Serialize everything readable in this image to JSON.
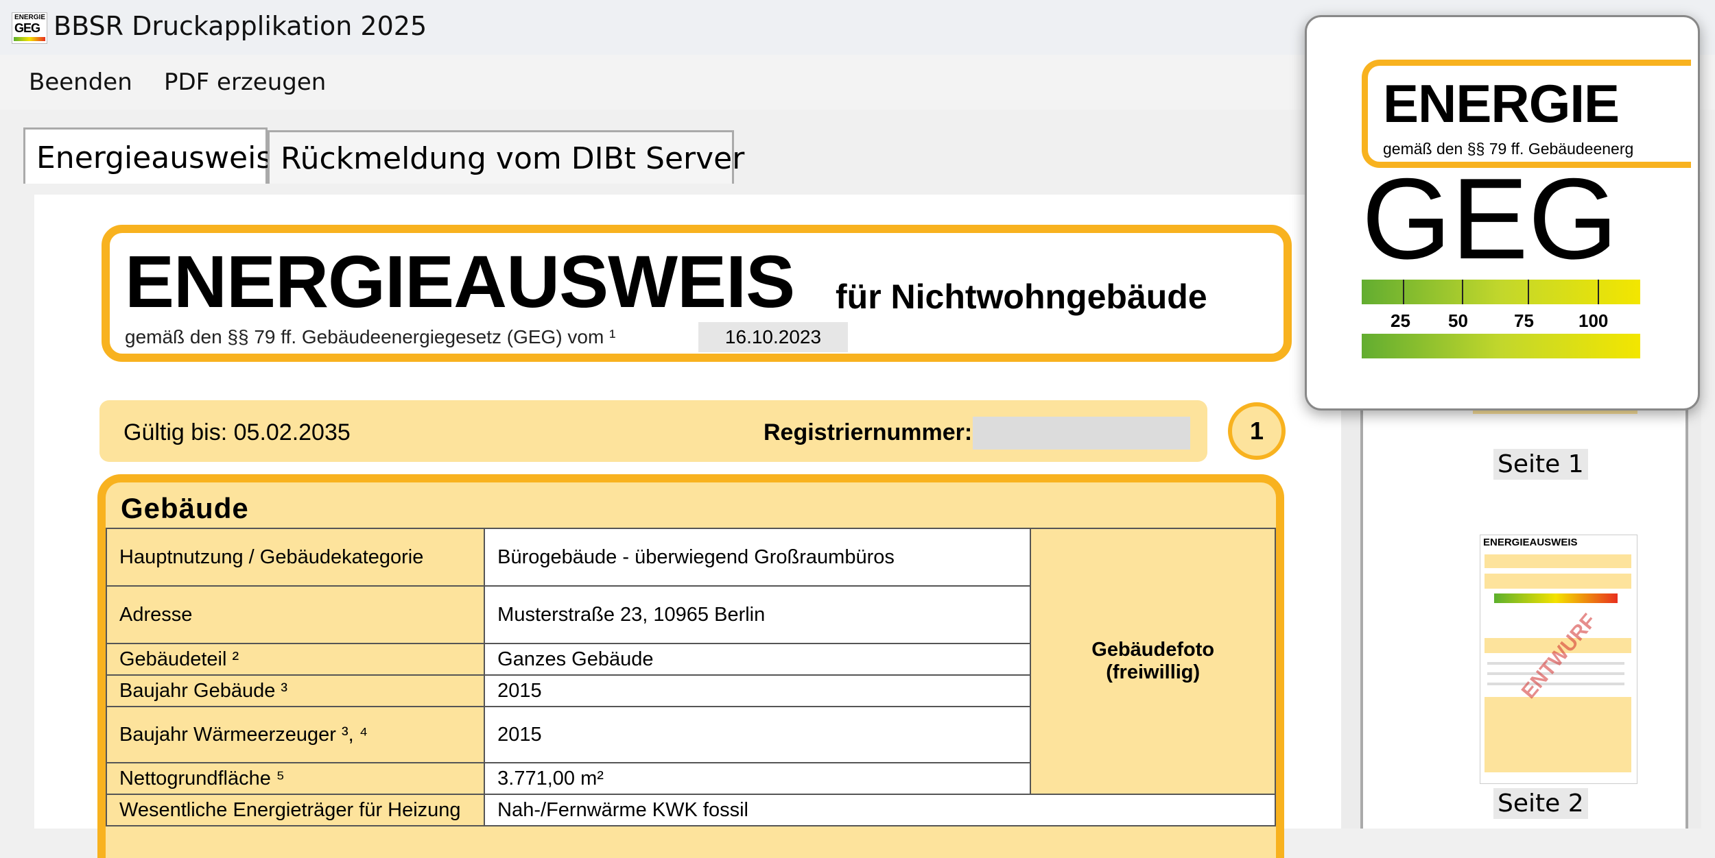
{
  "window": {
    "title": "BBSR Druckapplikation 2025",
    "icon_text_top": "ENERGIE",
    "icon_text_main": "GEG"
  },
  "menu": {
    "items": [
      "Beenden",
      "PDF erzeugen"
    ]
  },
  "tabs": [
    {
      "label": "Energieausweis",
      "active": true
    },
    {
      "label": "Rückmeldung vom DIBt Server",
      "active": false
    }
  ],
  "certificate": {
    "title": "ENERGIEAUSWEIS",
    "subtitle": "für Nichtwohngebäude",
    "law_line": "gemäß den §§ 79 ff. Gebäudeenergiegesetz (GEG) vom ¹",
    "law_date": "16.10.2023",
    "valid_until": "Gültig bis: 05.02.2035",
    "registration_label": "Registriernummer:",
    "registration_value": "",
    "page_badge": "1",
    "building": {
      "section_title": "Gebäude",
      "photo_label_line1": "Gebäudefoto",
      "photo_label_line2": "(freiwillig)",
      "rows": [
        {
          "label": "Hauptnutzung / Gebäudekategorie",
          "value": "Bürogebäude - überwiegend Großraumbüros"
        },
        {
          "label": "Adresse",
          "value": "Musterstraße 23, 10965 Berlin"
        },
        {
          "label": "Gebäudeteil ²",
          "value": "Ganzes Gebäude"
        },
        {
          "label": "Baujahr Gebäude ³",
          "value": "2015"
        },
        {
          "label": "Baujahr Wärmeerzeuger ³, ⁴",
          "value": "2015"
        },
        {
          "label": "Nettogrundfläche ⁵",
          "value": "3.771,00 m²"
        },
        {
          "label": "Wesentliche Energieträger für Heizung",
          "value": "Nah-/Fernwärme KWK fossil"
        }
      ]
    }
  },
  "thumbnails": {
    "page1_label": "Seite 1",
    "page2_label": "Seite 2",
    "page2_header": "ENERGIEAUSWEIS",
    "page2_stamp": "ENTWURF"
  },
  "logo_popup": {
    "energie": "ENERGIE",
    "law_line": "gemäß den §§ 79 ff. Gebäudeenerg",
    "geg": "GEG",
    "scale_labels": [
      "25",
      "50",
      "75",
      "100"
    ]
  },
  "colors": {
    "accent_orange": "#f8b21f",
    "panel_yellow": "#fde39c",
    "scale_green": "#62ad30",
    "scale_yellow": "#f3e600"
  }
}
